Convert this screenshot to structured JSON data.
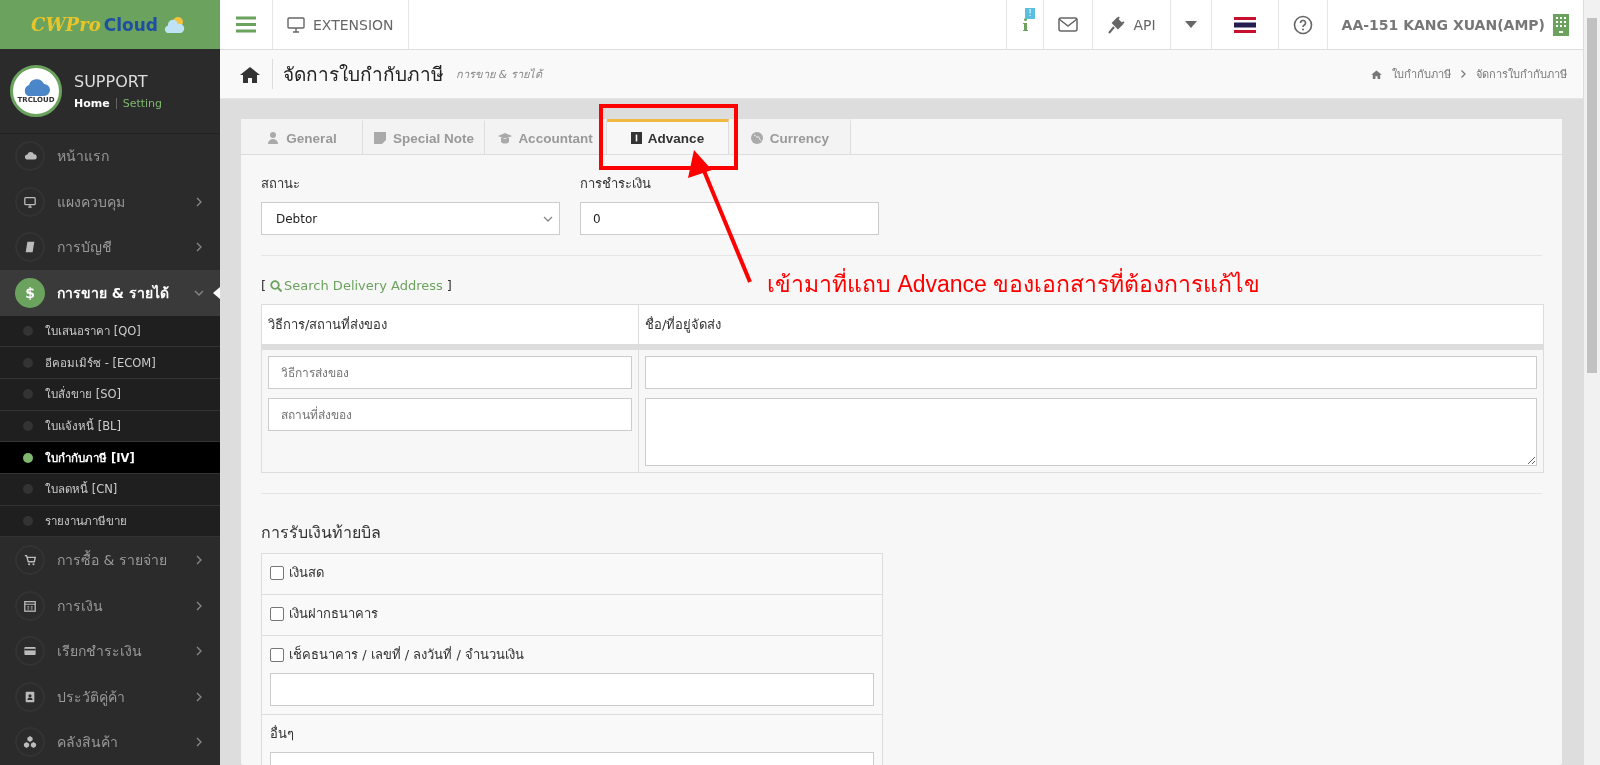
{
  "logo": {
    "text_1": "CWPro",
    "text_2": "Cloud"
  },
  "topbar": {
    "extension": "EXTENSION",
    "notification_badge": "!",
    "api": "API",
    "user": "AA-151 KANG XUAN(AMP)"
  },
  "profile": {
    "avatar_text": "TRCLOUD",
    "name": "SUPPORT",
    "home": "Home",
    "setting": "Setting"
  },
  "sidebar": {
    "items": [
      {
        "label": "หน้าแรก",
        "kind": "link",
        "selected": false,
        "expanded": false
      },
      {
        "label": "แผงควบคุม",
        "kind": "group",
        "selected": false,
        "expanded": false
      },
      {
        "label": "การบัญชี",
        "kind": "group",
        "selected": false,
        "expanded": false
      },
      {
        "label": "การขาย & รายได้",
        "icon_glyph": "$",
        "kind": "group",
        "selected": true,
        "expanded": true,
        "children": [
          {
            "label": "ใบเสนอราคา [QO]",
            "selected": false
          },
          {
            "label": "อีคอมเมิร์ซ - [ECOM]",
            "selected": false
          },
          {
            "label": "ใบสั่งขาย [SO]",
            "selected": false
          },
          {
            "label": "ใบแจ้งหนี้ [BL]",
            "selected": false
          },
          {
            "label": "ใบกำกับภาษี [IV]",
            "selected": true
          },
          {
            "label": "ใบลดหนี้ [CN]",
            "selected": false
          },
          {
            "label": "รายงานภาษีขาย",
            "selected": false
          }
        ]
      },
      {
        "label": "การซื้อ & รายจ่าย",
        "kind": "group",
        "selected": false,
        "expanded": false
      },
      {
        "label": "การเงิน",
        "kind": "group",
        "selected": false,
        "expanded": false
      },
      {
        "label": "เรียกชำระเงิน",
        "kind": "group",
        "selected": false,
        "expanded": false
      },
      {
        "label": "ประวัติคู่ค้า",
        "kind": "group",
        "selected": false,
        "expanded": false
      },
      {
        "label": "คลังสินค้า",
        "kind": "group",
        "selected": false,
        "expanded": false
      }
    ]
  },
  "page_header": {
    "title": "จัดการใบกำกับภาษี",
    "subtitle": "การขาย & รายได้",
    "breadcrumb": [
      "ใบกำกับภาษี",
      "จัดการใบกำกับภาษี"
    ]
  },
  "tabs": [
    {
      "label": "General",
      "selected": false
    },
    {
      "label": "Special Note",
      "selected": false
    },
    {
      "label": "Accountant",
      "selected": false
    },
    {
      "label": "Advance",
      "selected": true
    },
    {
      "label": "Currency",
      "selected": false
    }
  ],
  "form": {
    "status_label": "สถานะ",
    "status_value": "Debtor",
    "payment_label": "การชำระเงิน",
    "payment_value": "0"
  },
  "delivery": {
    "open_bracket": "[",
    "search_link": "Search Delivery Address",
    "close_bracket": "]",
    "columns": [
      "วิธีการ/สถานที่ส่งของ",
      "ชื่อ/ที่อยู่จัดส่ง"
    ],
    "placeholders": [
      "วิธีการส่งของ",
      "สถานที่ส่งของ"
    ]
  },
  "payment_section": {
    "title": "การรับเงินท้ายบิล",
    "options": [
      {
        "kind": "checkbox",
        "label": "เงินสด",
        "checked": false
      },
      {
        "kind": "checkbox",
        "label": "เงินฝากธนาคาร",
        "checked": false
      },
      {
        "kind": "checkbox-input",
        "label": "เช็คธนาคาร / เลขที่ / ลงวันที่ / จำนวนเงิน",
        "checked": false
      },
      {
        "kind": "input",
        "label": "อื่นๆ"
      }
    ]
  },
  "annotation": {
    "text": "เข้ามาที่แถบ Advance ของเอกสารที่ต้องการแก้ไข"
  }
}
